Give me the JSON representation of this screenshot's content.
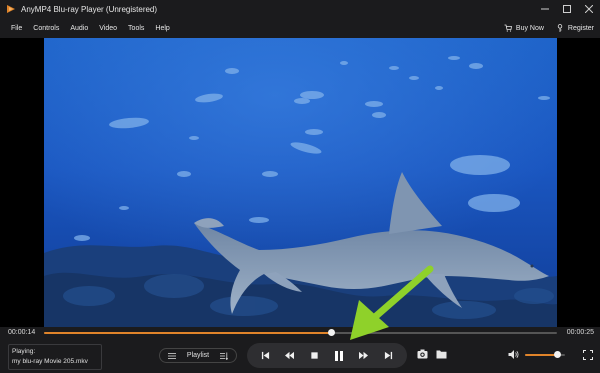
{
  "window": {
    "title": "AnyMP4 Blu-ray Player (Unregistered)",
    "controls": [
      "minimize",
      "maximize",
      "close"
    ]
  },
  "menu": {
    "items": [
      "File",
      "Controls",
      "Audio",
      "Video",
      "Tools",
      "Help"
    ],
    "buy_now": "Buy Now",
    "register": "Register"
  },
  "player": {
    "current_time": "00:00:14",
    "total_time": "00:00:25",
    "progress": 0.56,
    "now_playing_label": "Playing:",
    "now_playing_file": "my blu-ray Movie 205.mkv",
    "playlist_label": "Playlist",
    "volume": 0.8
  },
  "colors": {
    "accent": "#e0842a",
    "annotation": "#8fd12a",
    "background": "#1b1b1d"
  },
  "icons": {
    "transport": [
      "skip-previous-icon",
      "rewind-icon",
      "stop-icon",
      "pause-icon",
      "fast-forward-icon",
      "skip-next-icon"
    ],
    "extra": [
      "snapshot-icon",
      "open-folder-icon"
    ]
  }
}
